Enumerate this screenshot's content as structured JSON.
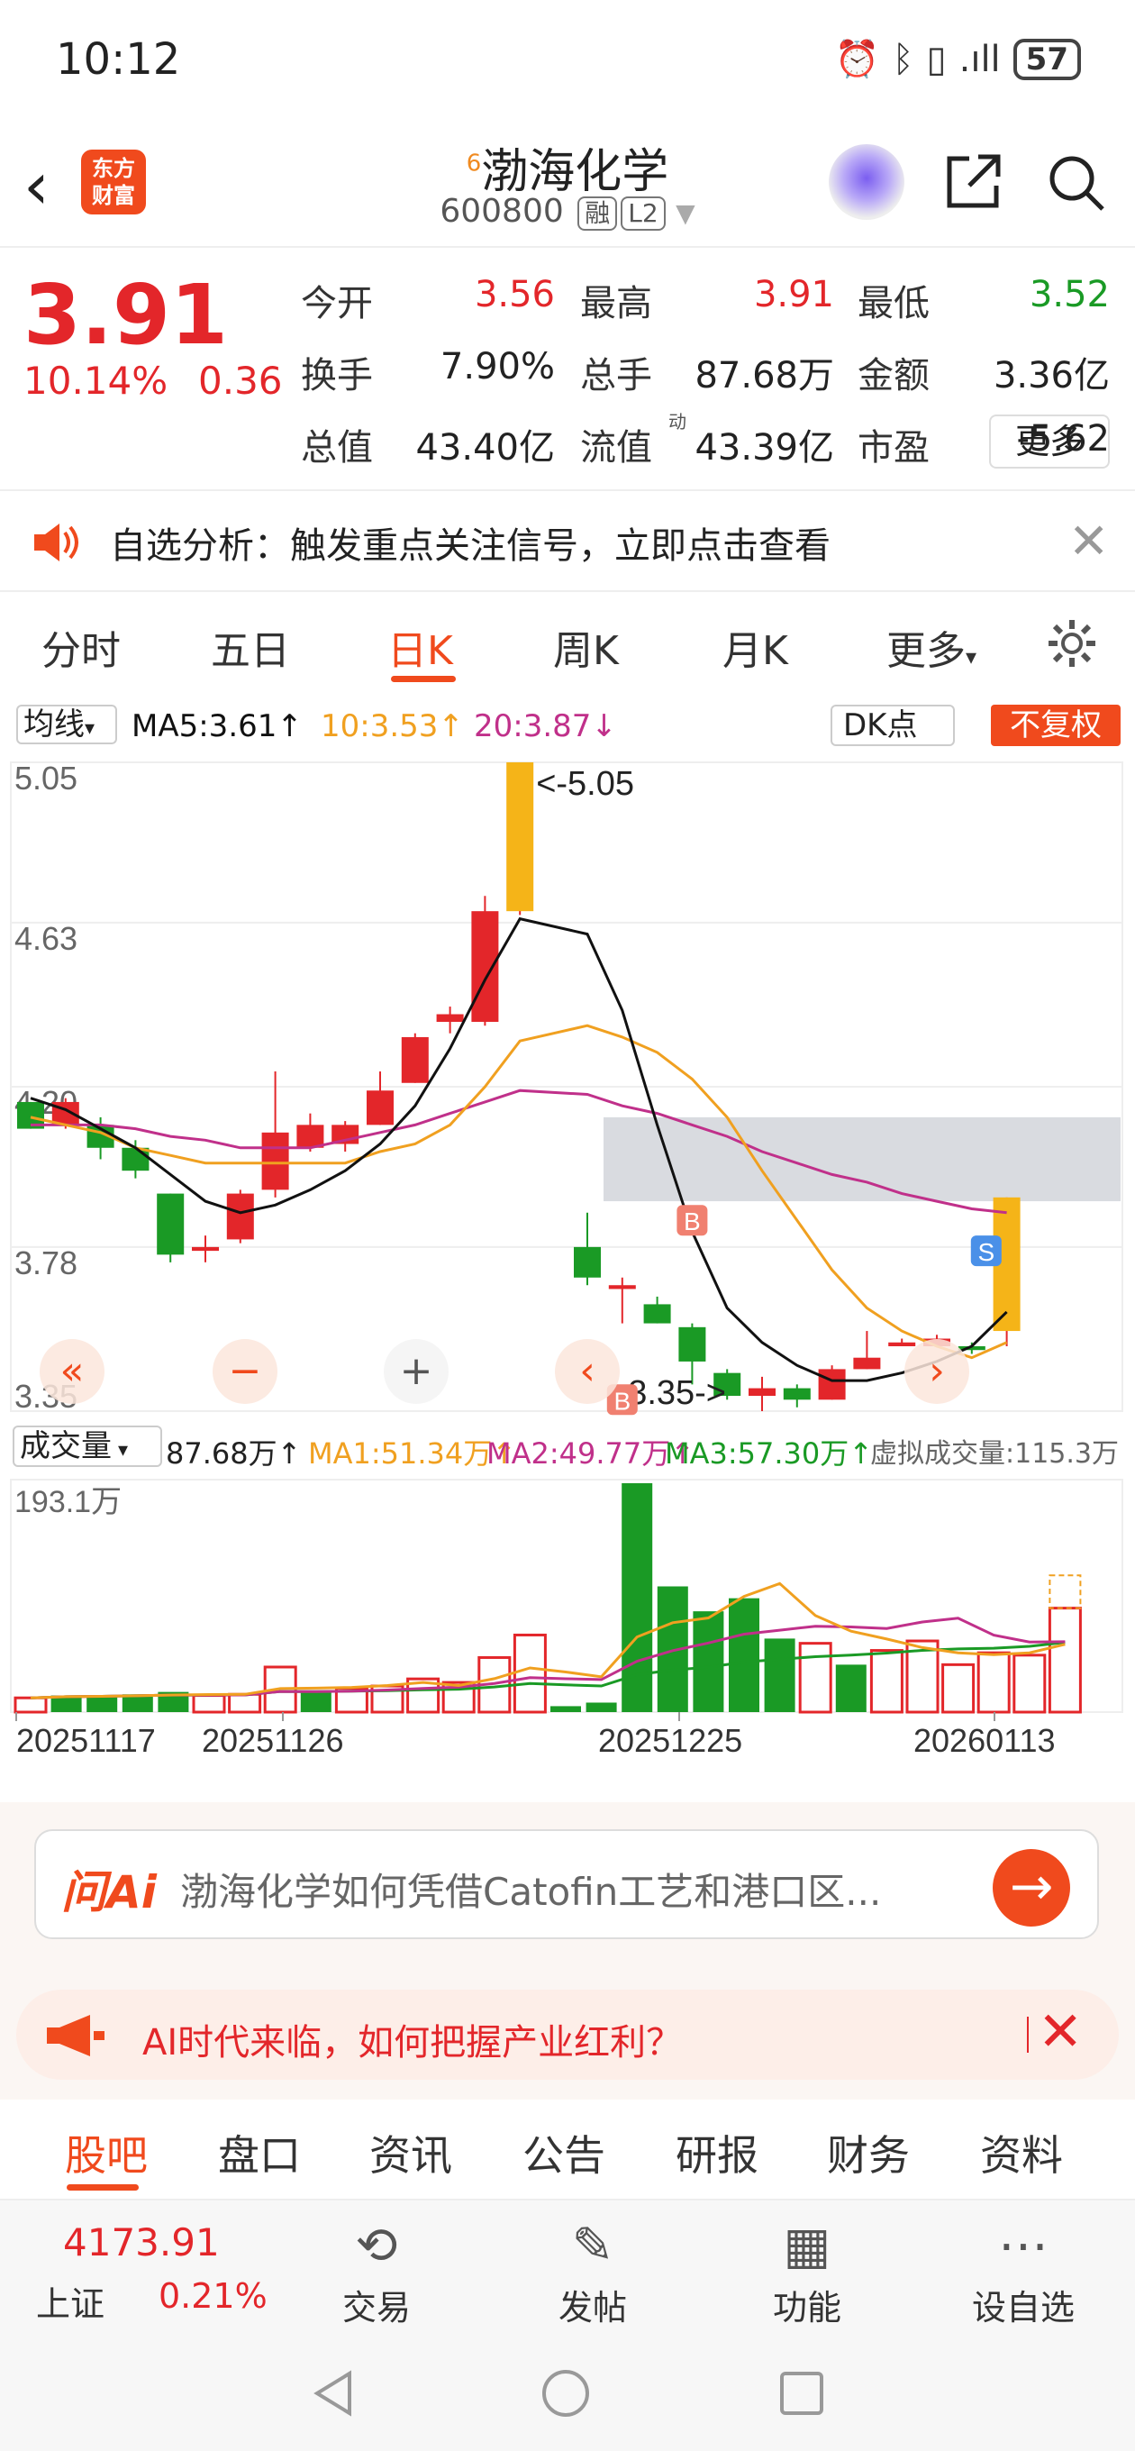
{
  "status_bar": {
    "time": "10:12",
    "battery": "57",
    "signal": ".ıll"
  },
  "header": {
    "title": "渤海化学",
    "superscript": "6",
    "code": "600800",
    "tag_margin": "融",
    "tag_level": "L2",
    "logo_line1": "东方",
    "logo_line2": "财富"
  },
  "quote": {
    "price": "3.91",
    "change_pct": "10.14%",
    "change_amt": "0.36",
    "fields": [
      {
        "label": "今开",
        "value": "3.56",
        "color": "red"
      },
      {
        "label": "最高",
        "value": "3.91",
        "color": "red"
      },
      {
        "label": "最低",
        "value": "3.52",
        "color": "grn"
      },
      {
        "label": "换手",
        "value": "7.90%",
        "color": "blk"
      },
      {
        "label": "总手",
        "value": "87.68万",
        "color": "blk"
      },
      {
        "label": "金额",
        "value": "3.36亿",
        "color": "blk"
      },
      {
        "label": "总值",
        "value": "43.40亿",
        "color": "blk"
      },
      {
        "label": "流值",
        "value": "43.39亿",
        "color": "blk"
      },
      {
        "label": "市盈",
        "value": "-5.62",
        "color": "blk"
      }
    ],
    "pe_sup": "动",
    "more": "更多"
  },
  "notice": {
    "text": "自选分析：触发重点关注信号，立即点击查看"
  },
  "chart_tabs": [
    "分时",
    "五日",
    "日K",
    "周K",
    "月K",
    "更多"
  ],
  "active_chart_tab": 2,
  "ma_bar": {
    "selector": "均线",
    "ma5": "MA5:3.61↑",
    "ma10": "10:3.53↑",
    "ma20": "20:3.87↓",
    "dk": "DK点",
    "adjust": "不复权"
  },
  "chart_data": {
    "type": "candlestick",
    "y_ticks": [
      "5.05",
      "4.63",
      "4.20",
      "3.78",
      "3.35"
    ],
    "ylim": [
      3.35,
      5.05
    ],
    "x_labels": [
      "20251117",
      "20251126",
      "20251225",
      "20260113"
    ],
    "annotations": {
      "high": "<-5.05",
      "low": "3.35->",
      "buy": "B",
      "sell": "S"
    },
    "candles": [
      [
        4.16,
        4.09,
        4.16,
        4.09
      ],
      [
        4.1,
        4.16,
        4.17,
        4.09
      ],
      [
        4.1,
        4.04,
        4.12,
        4.01
      ],
      [
        4.04,
        3.98,
        4.06,
        3.96
      ],
      [
        3.92,
        3.76,
        3.92,
        3.74
      ],
      [
        3.77,
        3.78,
        3.81,
        3.74
      ],
      [
        3.8,
        3.92,
        3.93,
        3.79
      ],
      [
        3.93,
        4.08,
        4.24,
        3.91
      ],
      [
        4.04,
        4.1,
        4.13,
        4.03
      ],
      [
        4.05,
        4.1,
        4.11,
        4.03
      ],
      [
        4.1,
        4.19,
        4.24,
        4.1
      ],
      [
        4.21,
        4.33,
        4.34,
        4.21
      ],
      [
        4.37,
        4.39,
        4.41,
        4.34
      ],
      [
        4.37,
        4.66,
        4.7,
        4.36
      ],
      [
        4.66,
        5.05,
        5.05,
        4.65
      ],
      [
        3.78,
        3.7,
        3.87,
        3.68
      ],
      [
        3.67,
        3.68,
        3.7,
        3.58
      ],
      [
        3.63,
        3.58,
        3.65,
        3.58
      ],
      [
        3.57,
        3.48,
        3.58,
        3.42
      ],
      [
        3.45,
        3.39,
        3.46,
        3.38
      ],
      [
        3.39,
        3.41,
        3.44,
        3.35
      ],
      [
        3.41,
        3.38,
        3.42,
        3.36
      ],
      [
        3.38,
        3.46,
        3.47,
        3.38
      ],
      [
        3.46,
        3.49,
        3.56,
        3.46
      ],
      [
        3.52,
        3.53,
        3.54,
        3.52
      ],
      [
        3.52,
        3.54,
        3.55,
        3.52
      ],
      [
        3.52,
        3.51,
        3.53,
        3.5
      ],
      [
        3.56,
        3.91,
        3.91,
        3.52
      ]
    ],
    "ma5": [
      4.17,
      4.14,
      4.09,
      4.04,
      3.97,
      3.9,
      3.87,
      3.89,
      3.93,
      3.98,
      4.05,
      4.15,
      4.3,
      4.48,
      4.64,
      4.6,
      4.4,
      4.1,
      3.82,
      3.62,
      3.53,
      3.47,
      3.43,
      3.43,
      3.45,
      3.48,
      3.52,
      3.61
    ],
    "ma10": [
      4.12,
      4.1,
      4.08,
      4.04,
      4.02,
      4.0,
      4.0,
      4.0,
      4.0,
      4.0,
      4.03,
      4.05,
      4.1,
      4.2,
      4.32,
      4.36,
      4.33,
      4.29,
      4.22,
      4.12,
      3.98,
      3.85,
      3.72,
      3.62,
      3.56,
      3.52,
      3.49,
      3.53
    ],
    "ma20": [
      4.1,
      4.1,
      4.1,
      4.09,
      4.07,
      4.06,
      4.04,
      4.04,
      4.04,
      4.06,
      4.08,
      4.1,
      4.13,
      4.16,
      4.19,
      4.18,
      4.15,
      4.13,
      4.1,
      4.07,
      4.03,
      4.0,
      3.97,
      3.95,
      3.92,
      3.9,
      3.88,
      3.87
    ],
    "volume": {
      "summary": "87.68万↑",
      "ma1": "MA1:51.34万↑",
      "ma2": "MA2:49.77万↑",
      "ma3": "MA3:57.30万↑",
      "virtual": "虚拟成交量:115.3万",
      "max_label": "193.1万",
      "selector": "成交量",
      "values": [
        12,
        14,
        14,
        15,
        17,
        14,
        15,
        38,
        17,
        20,
        22,
        28,
        25,
        46,
        65,
        5,
        8,
        193,
        106,
        85,
        96,
        62,
        58,
        40,
        52,
        60,
        40,
        50,
        48,
        87.68
      ],
      "up": [
        1,
        0,
        0,
        0,
        0,
        1,
        1,
        1,
        0,
        1,
        1,
        1,
        1,
        1,
        1,
        0,
        0,
        0,
        0,
        0,
        0,
        0,
        1,
        0,
        1,
        1,
        1,
        1,
        1,
        1
      ]
    }
  },
  "ai": {
    "logo": "问Ai",
    "question": "渤海化学如何凭借Catofin工艺和港口区...",
    "banner": "AI时代来临，如何把握产业红利？"
  },
  "bottom_tabs": [
    "股吧",
    "盘口",
    "资讯",
    "公告",
    "研报",
    "财务",
    "资料"
  ],
  "bottom_nav": {
    "index_value": "4173.91",
    "index_name": "上证",
    "index_change": "0.21%",
    "items": [
      "交易",
      "发帖",
      "功能",
      "设自选"
    ]
  },
  "colors": {
    "up": "#e3262a",
    "down": "#1a9a25",
    "accent": "#f04a1d",
    "ma5": "#111111",
    "ma10": "#f0a020",
    "ma20": "#c0308a"
  }
}
